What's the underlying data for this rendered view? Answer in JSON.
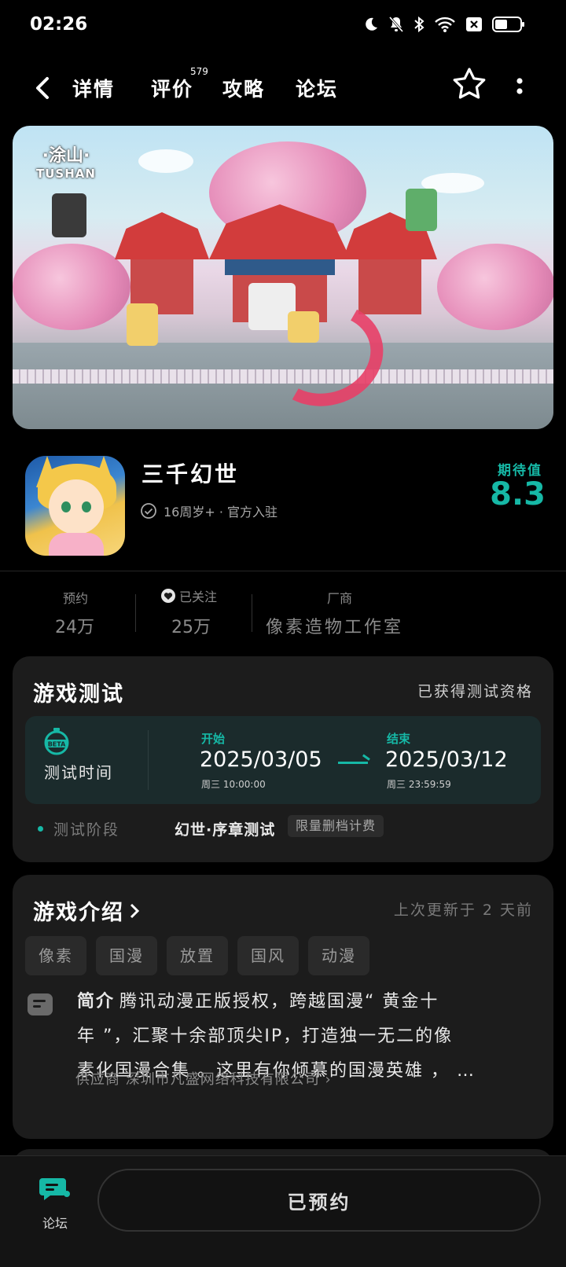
{
  "status_bar": {
    "time": "02:26"
  },
  "nav": {
    "tabs": [
      {
        "label": "详情"
      },
      {
        "label": "评价"
      },
      {
        "label": "攻略"
      },
      {
        "label": "论坛"
      }
    ],
    "review_count": "579",
    "accent_color": "#17b3a3"
  },
  "banner": {
    "logo_cn": "·涂山·",
    "logo_en": "TUSHAN"
  },
  "app": {
    "title": "三千幻世",
    "meta": "16周岁+ · 官方入驻",
    "expect_label": "期待值",
    "expect_score": "8.3"
  },
  "stats": {
    "reserve_label": "预约",
    "reserve_value": "24万",
    "follow_label": "已关注",
    "follow_value": "25万",
    "vendor_label": "厂商",
    "vendor_value": "像素造物工作室"
  },
  "test": {
    "title": "游戏测试",
    "qualified": "已获得测试资格",
    "time_label": "测试时间",
    "start_label": "开始",
    "start_date": "2025/03/05",
    "start_week": "周三  10:00:00",
    "end_label": "结束",
    "end_date": "2025/03/12",
    "end_week": "周三  23:59:59",
    "stage_label": "测试阶段",
    "stage_name": "幻世·序章测试",
    "stage_tag": "限量删档计费"
  },
  "intro": {
    "title": "游戏介绍",
    "updated": "上次更新于 2 天前",
    "tags": [
      "像素",
      "国漫",
      "放置",
      "国风",
      "动漫"
    ],
    "summary_label": "简介",
    "summary_line1": "腾讯动漫正版授权，跨越国漫“ 黄金十",
    "summary_line2": "年 ”，汇聚十余部顶尖IP，打造独一无二的像",
    "summary_line3": "素化国漫合集 。这里有你倾慕的国漫英雄 ， …",
    "supplier": "供应商 深圳市凡盛网络科技有限公司 ›"
  },
  "bottom": {
    "forum_label": "论坛",
    "reserve_button": "已预约"
  }
}
